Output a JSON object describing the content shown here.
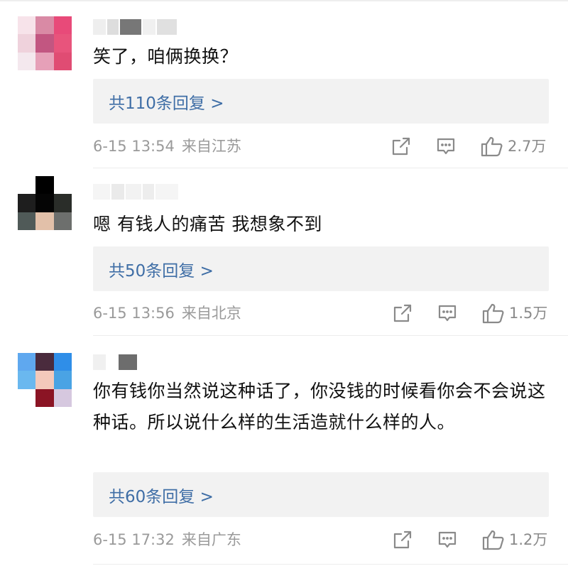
{
  "comments": [
    {
      "text": "笑了，咱俩换换？",
      "replies": "共110条回复 >",
      "time": "6-15 13:54",
      "location": "来自江苏",
      "likes": "2.7万",
      "avatar_colors": [
        "#f7e3ea",
        "#d98aa5",
        "#e84a79",
        "#efd2dc",
        "#c25681",
        "#e8547c",
        "#f4e8ee",
        "#e6a0b8",
        "#e04c73"
      ],
      "name_colors": [
        "#eeeeee",
        "#dddddd",
        "#777777",
        "#f0f0f0",
        "#e0e0e0"
      ]
    },
    {
      "text": "嗯 有钱人的痛苦 我想象不到",
      "replies": "共50条回复 >",
      "time": "6-15 13:56",
      "location": "来自北京",
      "likes": "1.5万",
      "avatar_colors": [
        "#ffffff",
        "#000000",
        "#ffffff",
        "#1e1e1e",
        "#050505",
        "#2a2d29",
        "#505a58",
        "#e2c0a9",
        "#6d6f6d"
      ],
      "name_colors": [
        "#f5f5f5",
        "#eaeaea",
        "#f2f2f2",
        "#ededed",
        "#f5f5f5"
      ]
    },
    {
      "text": "你有钱你当然说这种话了，你没钱的时候看你会不会说这种话。所以说什么样的生活造就什么样的人。",
      "replies": "共60条回复 >",
      "time": "6-15 17:32",
      "location": "来自广东",
      "likes": "1.2万",
      "avatar_colors": [
        "#5fa8ef",
        "#4a2b3d",
        "#2f8ee8",
        "#6ab8ef",
        "#f3c9bb",
        "#4aa3e4",
        "#ffffff",
        "#8b1424",
        "#d6c8df"
      ],
      "name_colors": [
        "#f0f0f0",
        "#ffffff",
        "#6d6d6d",
        "#ffffff",
        "#ffffff"
      ]
    }
  ]
}
